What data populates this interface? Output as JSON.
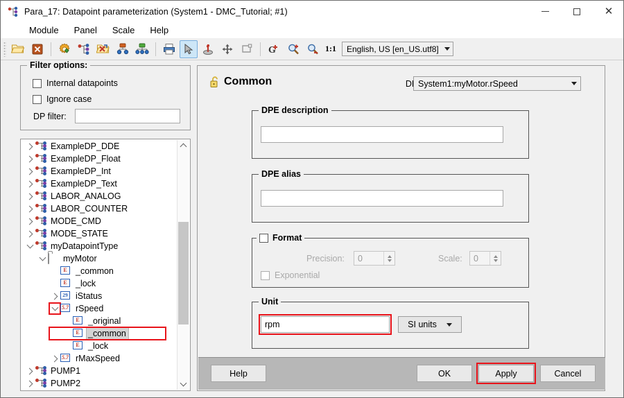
{
  "window": {
    "title": "Para_17: Datapoint parameterization (System1 - DMC_Tutorial; #1)",
    "icon": "datapoint-icon",
    "minimize": "–",
    "maximize": "□",
    "close": "✕"
  },
  "menu": {
    "items": [
      {
        "label": "Module"
      },
      {
        "label": "Panel"
      },
      {
        "label": "Scale"
      },
      {
        "label": "Help"
      }
    ]
  },
  "toolbar": {
    "buttons": [
      {
        "name": "open-folder-icon",
        "active": false
      },
      {
        "name": "close-panel-icon",
        "active": false
      },
      {
        "name": "settings-gear-icon",
        "active": false
      },
      {
        "name": "datapoint-tree-icon",
        "active": false
      },
      {
        "name": "folder-delete-icon",
        "active": false
      },
      {
        "name": "node-hierarchy-red-icon",
        "active": false
      },
      {
        "name": "node-hierarchy-green-icon",
        "active": false
      },
      {
        "name": "print-icon",
        "active": false
      },
      {
        "name": "select-cursor-icon",
        "active": true
      },
      {
        "name": "alert-handling-icon",
        "active": false
      },
      {
        "name": "move-icon",
        "active": false
      },
      {
        "name": "rectangle-select-icon",
        "active": false
      },
      {
        "name": "g-add-icon",
        "active": false
      },
      {
        "name": "zoom-in-icon",
        "active": false
      },
      {
        "name": "zoom-out-icon",
        "active": false
      }
    ],
    "ratio_label": "1:1",
    "locale": "English, US [en_US.utf8]"
  },
  "filter_options": {
    "legend": "Filter options:",
    "internal_datapoints": {
      "label": "Internal datapoints",
      "checked": false
    },
    "ignore_case": {
      "label": "Ignore case",
      "checked": false
    },
    "dp_filter": {
      "label": "DP filter:",
      "value": "",
      "placeholder": ""
    }
  },
  "tree": {
    "nodes": [
      {
        "label": "ExampleDP_DDE",
        "indent": 0,
        "expander": "right",
        "icon": "dptype-icon",
        "selected": false
      },
      {
        "label": "ExampleDP_Float",
        "indent": 0,
        "expander": "right",
        "icon": "dptype-icon",
        "selected": false
      },
      {
        "label": "ExampleDP_Int",
        "indent": 0,
        "expander": "right",
        "icon": "dptype-icon",
        "selected": false
      },
      {
        "label": "ExampleDP_Text",
        "indent": 0,
        "expander": "right",
        "icon": "dptype-icon",
        "selected": false
      },
      {
        "label": "LABOR_ANALOG",
        "indent": 0,
        "expander": "right",
        "icon": "dptype-icon",
        "selected": false
      },
      {
        "label": "LABOR_COUNTER",
        "indent": 0,
        "expander": "right",
        "icon": "dptype-icon",
        "selected": false
      },
      {
        "label": "MODE_CMD",
        "indent": 0,
        "expander": "right",
        "icon": "dptype-icon",
        "selected": false
      },
      {
        "label": "MODE_STATE",
        "indent": 0,
        "expander": "right",
        "icon": "dptype-icon",
        "selected": false
      },
      {
        "label": "myDatapointType",
        "indent": 0,
        "expander": "down",
        "icon": "dptype-icon",
        "selected": false
      },
      {
        "label": "myMotor",
        "indent": 1,
        "expander": "down",
        "icon": "folder-icon",
        "selected": false
      },
      {
        "label": "_common",
        "indent": 2,
        "expander": "none",
        "icon": "dpe-icon",
        "selected": false
      },
      {
        "label": "_lock",
        "indent": 2,
        "expander": "none",
        "icon": "dpe-icon",
        "selected": false
      },
      {
        "label": "iStatus",
        "indent": 2,
        "expander": "right",
        "icon": "dpe-int-icon",
        "selected": false
      },
      {
        "label": "rSpeed",
        "indent": 2,
        "expander": "down",
        "icon": "dpe-float-icon",
        "selected": false,
        "expander_highlight": true
      },
      {
        "label": "_original",
        "indent": 3,
        "expander": "none",
        "icon": "dpe-icon",
        "selected": false
      },
      {
        "label": "_common",
        "indent": 3,
        "expander": "none",
        "icon": "dpe-icon",
        "selected": true,
        "row_highlight": true
      },
      {
        "label": "_lock",
        "indent": 3,
        "expander": "none",
        "icon": "dpe-icon",
        "selected": false
      },
      {
        "label": "rMaxSpeed",
        "indent": 2,
        "expander": "right",
        "icon": "dpe-float-icon",
        "selected": false
      },
      {
        "label": "PUMP1",
        "indent": 0,
        "expander": "right",
        "icon": "dptype-icon",
        "selected": false
      },
      {
        "label": "PUMP2",
        "indent": 0,
        "expander": "right",
        "icon": "dptype-icon",
        "selected": false
      }
    ]
  },
  "panel": {
    "title": "Common",
    "title_icon": "unlocked-padlock-icon",
    "dpe_label": "DPE:",
    "dpe_value": "System1:myMotor.rSpeed",
    "dpe_description": {
      "legend": "DPE description",
      "value": ""
    },
    "dpe_alias": {
      "legend": "DPE alias",
      "value": ""
    },
    "format": {
      "legend": "Format",
      "checked": false,
      "precision_label": "Precision:",
      "precision_value": "0",
      "scale_label": "Scale:",
      "scale_value": "0",
      "exponential_label": "Exponential",
      "exponential_checked": false
    },
    "unit": {
      "legend": "Unit",
      "value": "rpm",
      "si_button": "SI units"
    }
  },
  "buttons": {
    "help": "Help",
    "ok": "OK",
    "apply": "Apply",
    "cancel": "Cancel"
  },
  "colors": {
    "highlight": "#e8141b",
    "toolbar_active": "#cde6f7",
    "button_bar": "#b7b7b7",
    "panel_bg": "#f0f0f0"
  }
}
